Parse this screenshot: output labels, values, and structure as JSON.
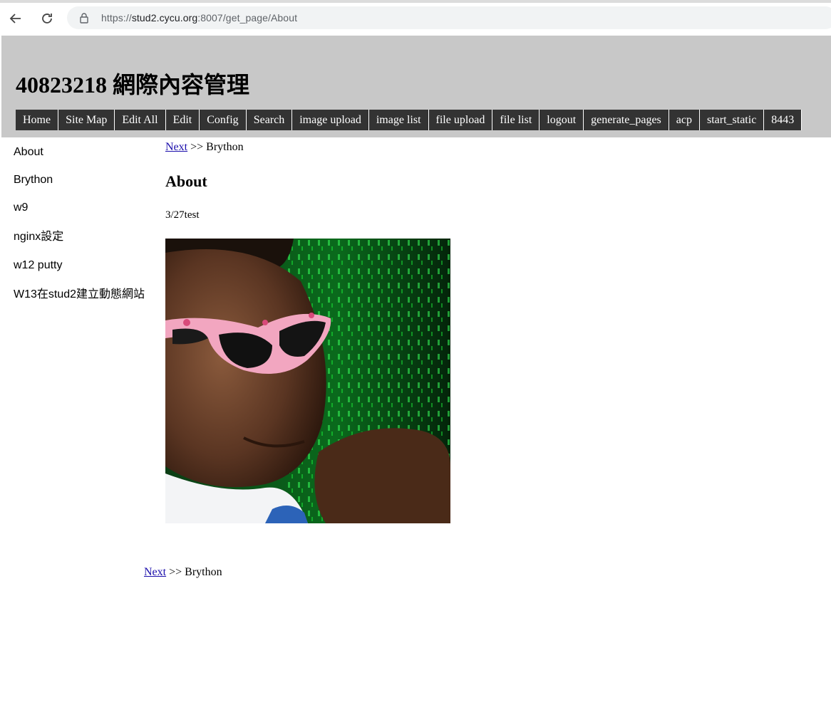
{
  "browser": {
    "url_scheme": "https://",
    "url_host": "stud2.cycu.org",
    "url_rest": ":8007/get_page/About"
  },
  "header": {
    "title": "40823218 網際內容管理",
    "menu": [
      "Home",
      "Site Map",
      "Edit All",
      "Edit",
      "Config",
      "Search",
      "image upload",
      "image list",
      "file upload",
      "file list",
      "logout",
      "generate_pages",
      "acp",
      "start_static",
      "8443"
    ]
  },
  "sidebar": {
    "items": [
      "About",
      "Brython",
      "w9",
      "nginx設定",
      "w12 putty",
      "W13在stud2建立動態網站"
    ]
  },
  "content": {
    "breadcrumb_link": "Next",
    "breadcrumb_rest": " >> Brython",
    "page_title": "About",
    "body_text": "3/27test",
    "image_alt": "Man wearing pink sunglasses in front of green matrix background"
  },
  "colors": {
    "header_bg": "#c8c8c8",
    "menu_bg": "#333333",
    "link": "#1a0dab"
  }
}
